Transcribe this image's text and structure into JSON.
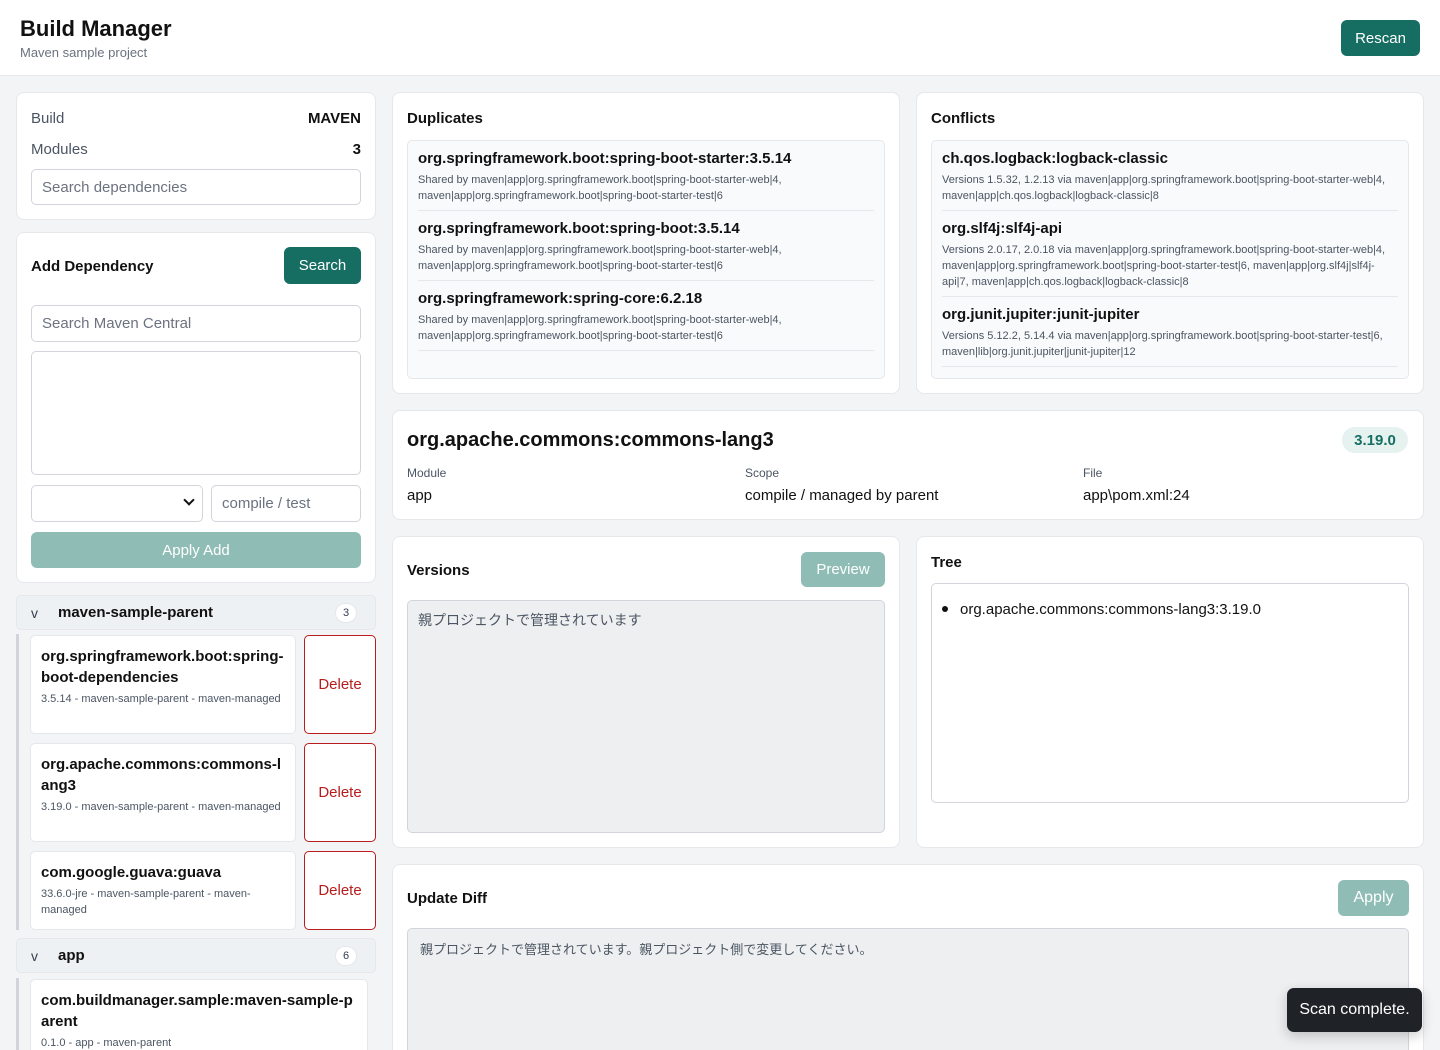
{
  "header": {
    "title": "Build Manager",
    "subtitle": "Maven sample project",
    "rescan_label": "Rescan"
  },
  "summary": {
    "build_label": "Build",
    "build_value": "MAVEN",
    "modules_label": "Modules",
    "modules_value": "3",
    "search_placeholder": "Search dependencies"
  },
  "add_dependency": {
    "title": "Add Dependency",
    "search_button": "Search",
    "central_placeholder": "Search Maven Central",
    "scope_placeholder": "compile / test",
    "apply_label": "Apply Add"
  },
  "groups": [
    {
      "caret": "v",
      "name": "maven-sample-parent",
      "count": "3",
      "deps": [
        {
          "name": "org.springframework.boot:spring-boot-dependencies",
          "meta": "3.5.14 - maven-sample-parent - maven-managed",
          "delete_label": "Delete"
        },
        {
          "name": "org.apache.commons:commons-lang3",
          "meta": "3.19.0 - maven-sample-parent - maven-managed",
          "delete_label": "Delete"
        },
        {
          "name": "com.google.guava:guava",
          "meta": "33.6.0-jre - maven-sample-parent - maven-managed",
          "delete_label": "Delete"
        }
      ]
    },
    {
      "caret": "v",
      "name": "app",
      "count": "6",
      "deps": [
        {
          "name": "com.buildmanager.sample:maven-sample-parent",
          "meta": "0.1.0 - app - maven-parent"
        }
      ]
    }
  ],
  "duplicates": {
    "title": "Duplicates",
    "items": [
      {
        "title": "org.springframework.boot:spring-boot-starter:3.5.14",
        "desc": "Shared by maven|app|org.springframework.boot|spring-boot-starter-web|4, maven|app|org.springframework.boot|spring-boot-starter-test|6"
      },
      {
        "title": "org.springframework.boot:spring-boot:3.5.14",
        "desc": "Shared by maven|app|org.springframework.boot|spring-boot-starter-web|4, maven|app|org.springframework.boot|spring-boot-starter-test|6"
      },
      {
        "title": "org.springframework:spring-core:6.2.18",
        "desc": "Shared by maven|app|org.springframework.boot|spring-boot-starter-web|4, maven|app|org.springframework.boot|spring-boot-starter-test|6"
      }
    ]
  },
  "conflicts": {
    "title": "Conflicts",
    "items": [
      {
        "title": "ch.qos.logback:logback-classic",
        "desc": "Versions 1.5.32, 1.2.13 via maven|app|org.springframework.boot|spring-boot-starter-web|4, maven|app|ch.qos.logback|logback-classic|8"
      },
      {
        "title": "org.slf4j:slf4j-api",
        "desc": "Versions 2.0.17, 2.0.18 via maven|app|org.springframework.boot|spring-boot-starter-web|4, maven|app|org.springframework.boot|spring-boot-starter-test|6, maven|app|org.slf4j|slf4j-api|7, maven|app|ch.qos.logback|logback-classic|8"
      },
      {
        "title": "org.junit.jupiter:junit-jupiter",
        "desc": "Versions 5.12.2, 5.14.4 via maven|app|org.springframework.boot|spring-boot-starter-test|6, maven|lib|org.junit.jupiter|junit-jupiter|12"
      }
    ]
  },
  "detail": {
    "name": "org.apache.commons:commons-lang3",
    "version": "3.19.0",
    "module_label": "Module",
    "module_value": "app",
    "scope_label": "Scope",
    "scope_value": "compile / managed by parent",
    "file_label": "File",
    "file_value": "app\\pom.xml:24"
  },
  "versions": {
    "title": "Versions",
    "preview_label": "Preview",
    "text": "親プロジェクトで管理されています"
  },
  "tree": {
    "title": "Tree",
    "items": [
      "org.apache.commons:commons-lang3:3.19.0"
    ]
  },
  "update_diff": {
    "title": "Update Diff",
    "apply_label": "Apply",
    "text": "親プロジェクトで管理されています。親プロジェクト側で変更してください。"
  },
  "toast": {
    "text": "Scan complete."
  },
  "colors": {
    "accent": "#166e63",
    "accent_disabled": "#8fbdb6",
    "danger": "#b91c1c"
  }
}
